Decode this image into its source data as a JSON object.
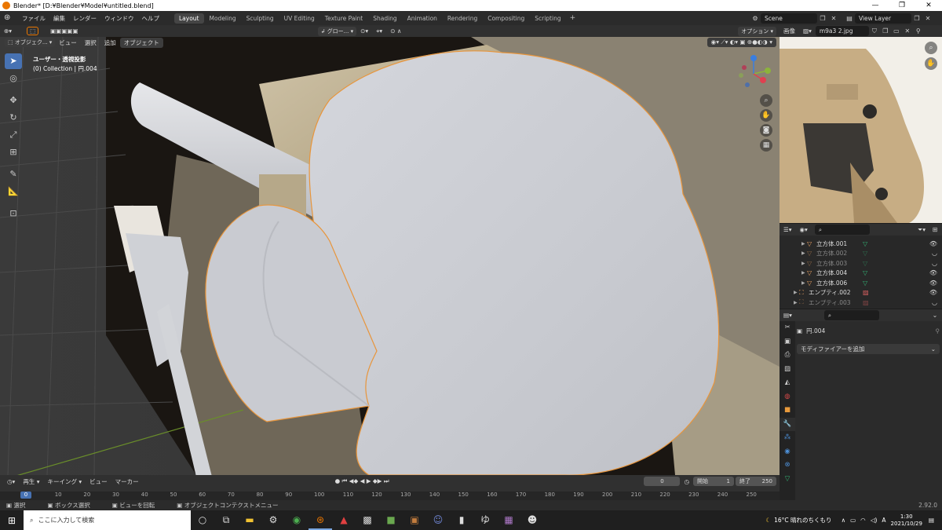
{
  "window": {
    "title": "Blender* [D:¥Blender¥Model¥untitled.blend]",
    "minimize": "—",
    "maximize": "❐",
    "close": "✕"
  },
  "menu": [
    "ファイル",
    "編集",
    "レンダー",
    "ウィンドウ",
    "ヘルプ"
  ],
  "workspaces": [
    "Layout",
    "Modeling",
    "Sculpting",
    "UV Editing",
    "Texture Paint",
    "Shading",
    "Animation",
    "Rendering",
    "Compositing",
    "Scripting"
  ],
  "active_workspace": "Layout",
  "scene": {
    "label": "Scene",
    "view_layer": "View Layer"
  },
  "viewport": {
    "mode": "オブジェク...",
    "menus": [
      "ビュー",
      "選択",
      "追加",
      "オブジェクト"
    ],
    "orientation": "グロー...",
    "options": "オプション",
    "info_line1": "ユーザー・透視投影",
    "info_line2": "(0) Collection | 円.004"
  },
  "image_editor": {
    "label": "画像",
    "image_name": "m9a3 2.jpg"
  },
  "outliner": {
    "rows": [
      {
        "name": "立方体.001",
        "dim": false
      },
      {
        "name": "立方体.002",
        "dim": true
      },
      {
        "name": "立方体.003",
        "dim": true
      },
      {
        "name": "立方体.004",
        "dim": false
      },
      {
        "name": "立方体.006",
        "dim": false
      },
      {
        "name": "エンプティ.002",
        "dim": false
      },
      {
        "name": "エンプティ.003",
        "dim": true
      }
    ]
  },
  "properties": {
    "object_name": "円.004",
    "add_modifier": "モディファイアーを追加"
  },
  "timeline": {
    "playback": "再生",
    "keying": "キーイング",
    "view": "ビュー",
    "marker": "マーカー",
    "current_frame": "0",
    "start_label": "開始",
    "start": "1",
    "end_label": "終了",
    "end": "250",
    "ruler": [
      "0",
      "10",
      "20",
      "30",
      "40",
      "50",
      "60",
      "70",
      "80",
      "90",
      "100",
      "110",
      "120",
      "130",
      "140",
      "150",
      "160",
      "170",
      "180",
      "190",
      "200",
      "210",
      "220",
      "230",
      "240",
      "250"
    ]
  },
  "statusbar": {
    "select": "選択",
    "box_select": "ボックス選択",
    "rotate_view": "ビューを回転",
    "context_menu": "オブジェクトコンテクストメニュー",
    "version": "2.92.0"
  },
  "taskbar": {
    "search": "ここに入力して検索",
    "weather": "16°C  晴れのちくもり",
    "time": "1:30",
    "date": "2021/10/29",
    "lang": "A"
  }
}
